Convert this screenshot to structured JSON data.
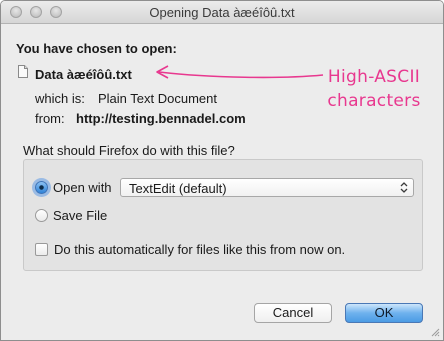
{
  "window": {
    "title": "Opening Data àæéîôû.txt"
  },
  "dialog": {
    "heading": "You have chosen to open:",
    "filename": "Data àæéîôû.txt",
    "which_is_label": "which is:",
    "which_is_value": "Plain Text Document",
    "from_label": "from:",
    "from_value": "http://testing.bennadel.com",
    "annotation_line1": "High-ASCII",
    "annotation_line2": "characters",
    "question": "What should Firefox do with this file?",
    "open_with_label": "Open with",
    "open_with_selected": "TextEdit (default)",
    "save_file_label": "Save File",
    "auto_label": "Do this automatically for files like this from now on.",
    "selected_option": "open_with",
    "auto_checked": false
  },
  "buttons": {
    "cancel_label": "Cancel",
    "ok_label": "OK"
  },
  "colors": {
    "annotation": "#e8388f",
    "default_button": "#4b9be4"
  },
  "icons": {
    "file": "document-icon",
    "select": "chevron-up-down-icon",
    "grip": "resize-grip-icon"
  }
}
